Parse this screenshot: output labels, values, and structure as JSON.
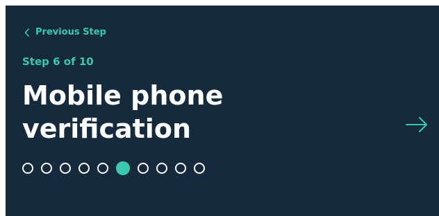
{
  "navigation": {
    "previous_label": "Previous Step",
    "previous_icon": "chevron-left-icon",
    "next_icon": "arrow-right-icon"
  },
  "step": {
    "label": "Step 6 of 10",
    "current": 6,
    "total": 10
  },
  "title_lines": [
    "Mobile phone",
    "verification"
  ],
  "colors": {
    "background": "#152a3c",
    "accent": "#3ac9b0",
    "text": "#ffffff"
  }
}
